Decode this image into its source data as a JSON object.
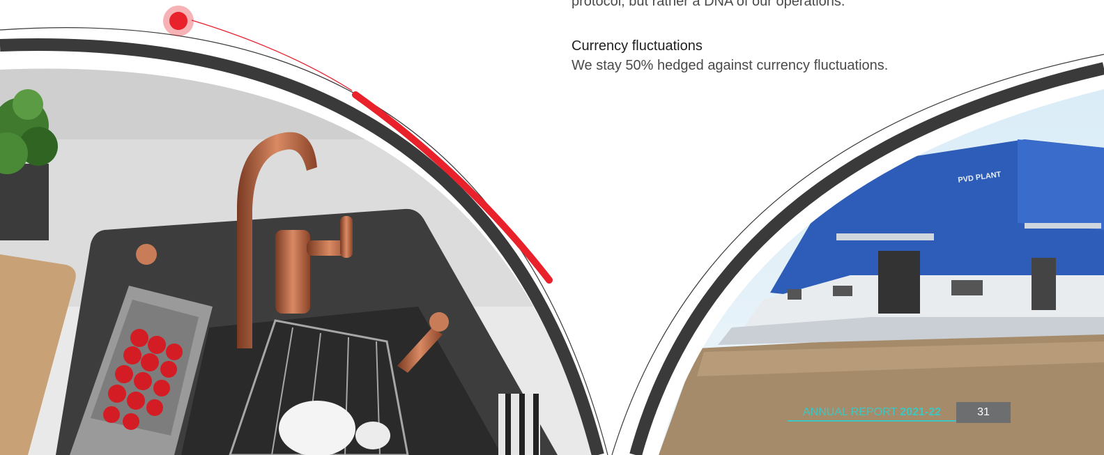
{
  "body_text": {
    "top_fragment": "protocol, but rather a DNA of our operations.",
    "heading": "Currency fluctuations",
    "paragraph": "We stay 50% hedged against currency fluctuations."
  },
  "photos": {
    "plant_sign": "PVD PLANT"
  },
  "footer": {
    "label": "ANNUAL REPORT ",
    "year": "2021-22",
    "page_number": "31"
  },
  "colors": {
    "accent_red": "#e8212b",
    "arc_dark": "#3a3a3a",
    "accent_teal": "#3ec6c2",
    "page_box": "#6d6e70"
  }
}
